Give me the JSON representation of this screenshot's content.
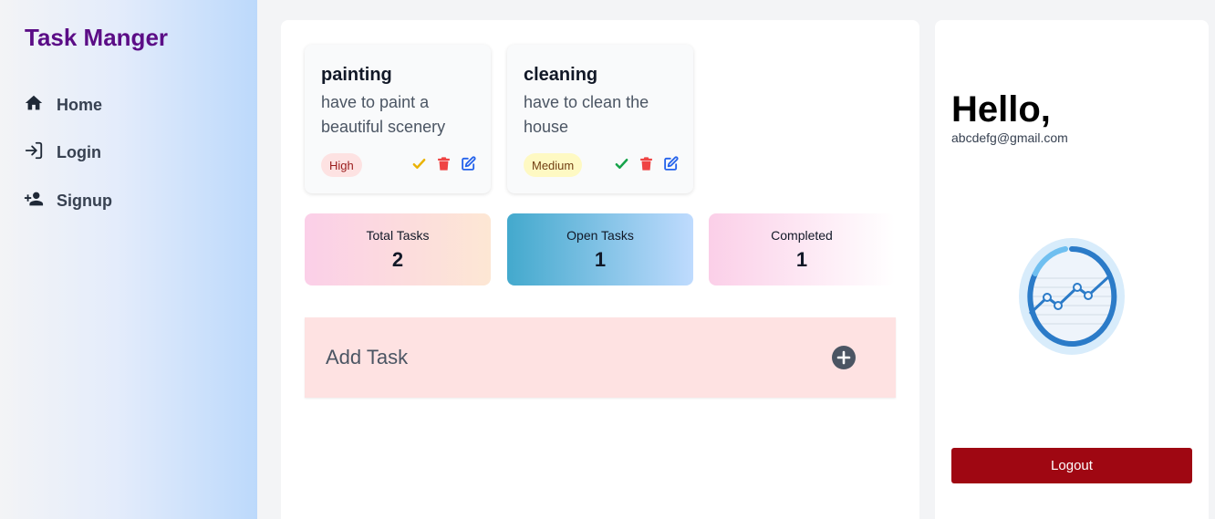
{
  "app": {
    "title": "Task Manger"
  },
  "sidebar": {
    "items": [
      {
        "label": "Home",
        "icon": "home-icon"
      },
      {
        "label": "Login",
        "icon": "login-icon"
      },
      {
        "label": "Signup",
        "icon": "add-user-icon"
      }
    ]
  },
  "tasks": [
    {
      "title": "painting",
      "description": "have to paint a beautiful scenery",
      "priority": "High",
      "check_color": "#eab308"
    },
    {
      "title": "cleaning",
      "description": "have to clean the house",
      "priority": "Medium",
      "check_color": "#16a34a"
    }
  ],
  "stats": [
    {
      "label": "Total Tasks",
      "value": "2"
    },
    {
      "label": "Open Tasks",
      "value": "1"
    },
    {
      "label": "Completed",
      "value": "1"
    }
  ],
  "add_task": {
    "label": "Add Task"
  },
  "profile": {
    "greeting": "Hello,",
    "email": "abcdefg@gmail.com",
    "logout_label": "Logout"
  },
  "colors": {
    "brand": "#5b0d86",
    "logout": "#9f0712",
    "delete": "#ef4444",
    "edit": "#2563eb"
  }
}
